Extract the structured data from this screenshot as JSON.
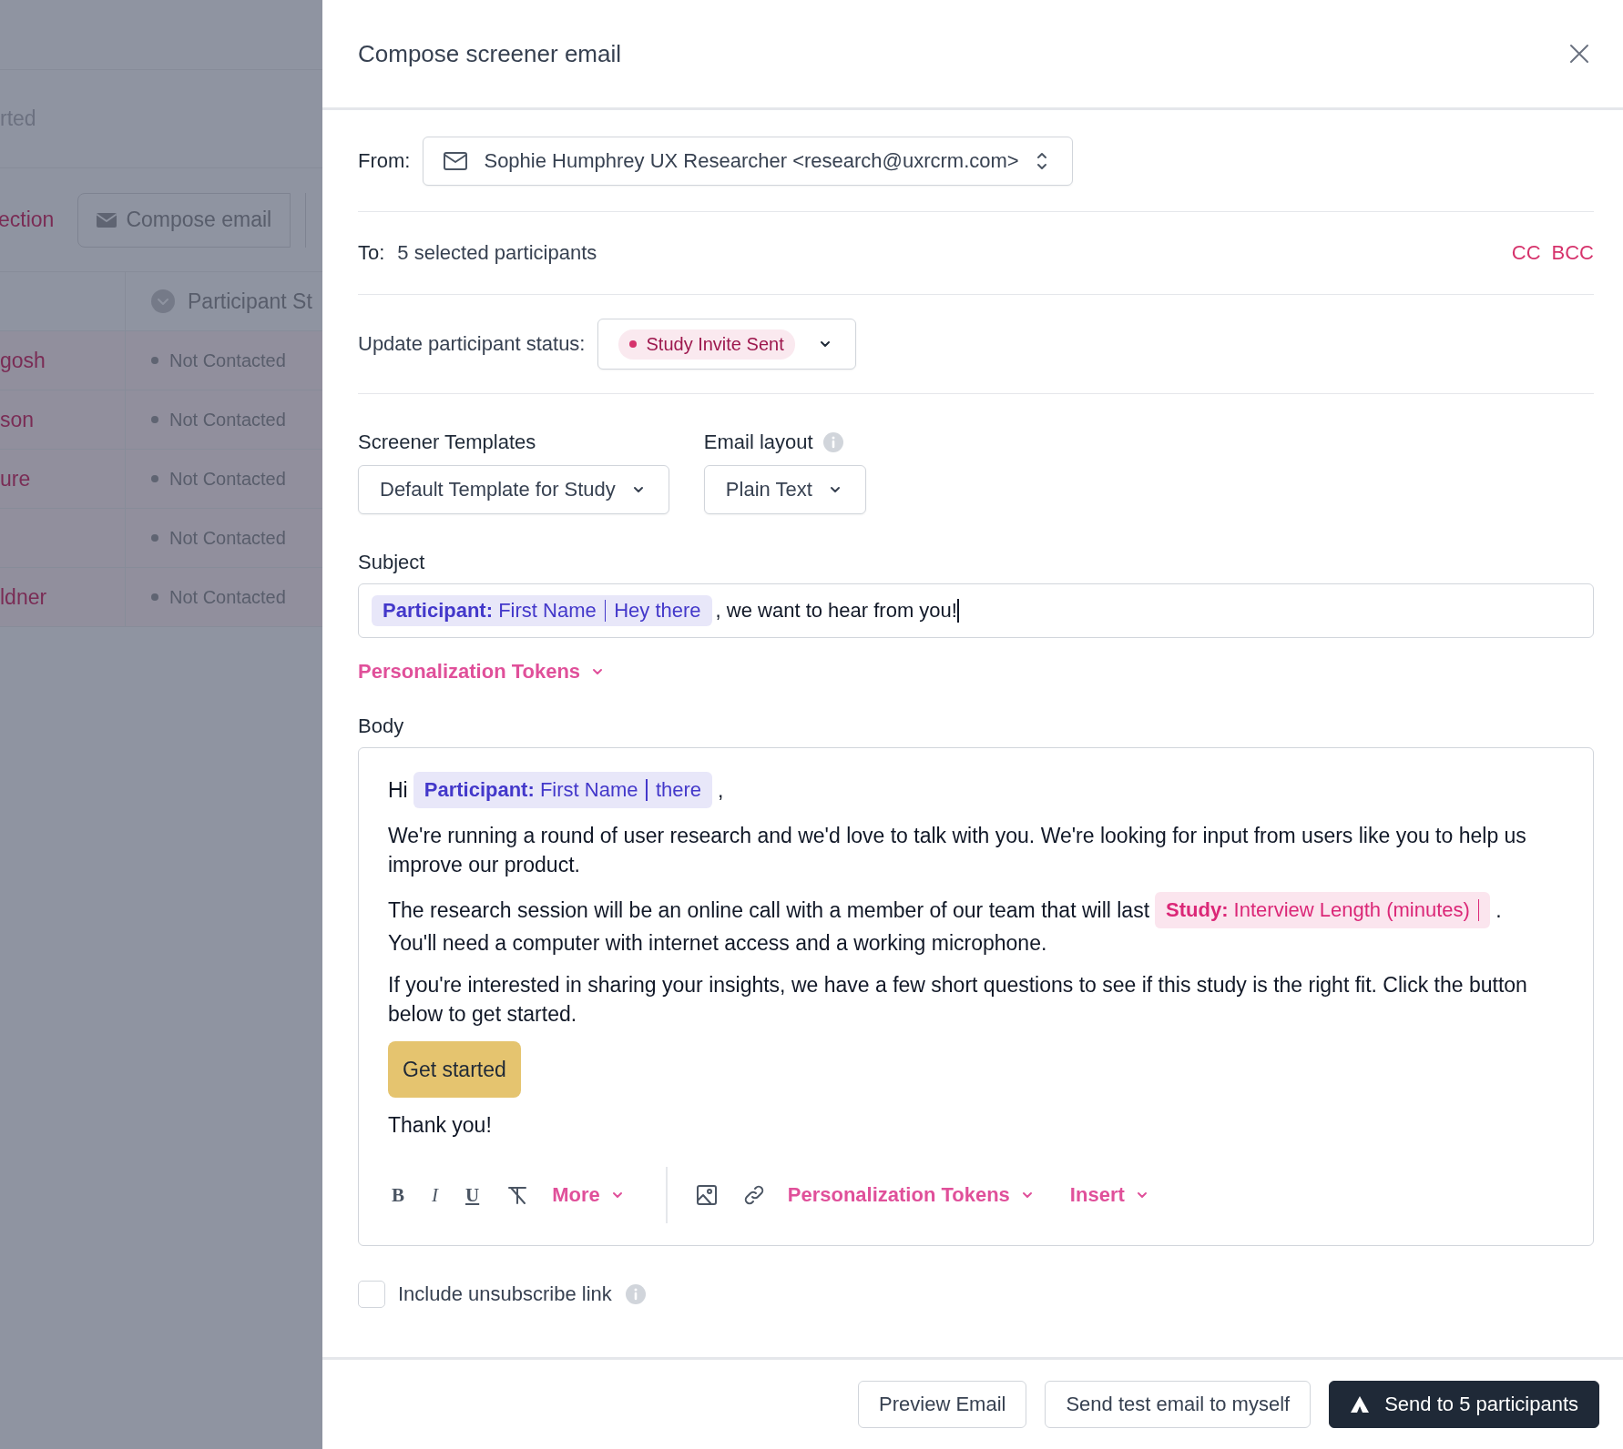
{
  "background": {
    "header_text": "rted",
    "section_link": "ection",
    "toolbar_button": "Compose email",
    "column_header": "Participant St",
    "rows": [
      {
        "name": "gosh",
        "status": "Not Contacted"
      },
      {
        "name": "son",
        "status": "Not Contacted"
      },
      {
        "name": "ure",
        "status": "Not Contacted"
      },
      {
        "status": "Not Contacted"
      },
      {
        "name": "ldner",
        "status": "Not Contacted"
      }
    ]
  },
  "modal": {
    "title": "Compose screener email",
    "from": {
      "label": "From:",
      "value": "Sophie Humphrey UX Researcher <research@uxrcrm.com>"
    },
    "to": {
      "label": "To:",
      "value": "5 selected participants",
      "links": [
        "CC",
        "BCC"
      ]
    },
    "status": {
      "label": "Update participant status:",
      "value": "Study Invite Sent",
      "color": "#d6336c"
    },
    "templates": {
      "label": "Screener Templates",
      "value": "Default Template for Study"
    },
    "layout": {
      "label": "Email layout",
      "value": "Plain Text"
    },
    "subject": {
      "label": "Subject",
      "parts": [
        {
          "kind": "token",
          "text": "**Participant:** First Name",
          "fallback": "Hey there",
          "color": "#4338ca"
        },
        {
          "kind": "text",
          "text": ", we want to hear from you!"
        }
      ]
    },
    "tokens_link": "Personalization Tokens",
    "body": {
      "label": "Body",
      "blocks": [
        {
          "kind": "paragraph",
          "parts": [
            {
              "kind": "text",
              "text": "Hi"
            },
            {
              "kind": "token",
              "text": "**Participant:** First Name",
              "fallback": "there",
              "color": "#4338ca"
            },
            {
              "kind": "text",
              "text": ","
            }
          ]
        },
        {
          "kind": "paragraph",
          "parts": [
            {
              "kind": "text",
              "text": "We're running a round of user research and we'd love to talk with you. We're looking for input from users like you to help us improve our product."
            }
          ]
        },
        {
          "kind": "paragraph",
          "parts": [
            {
              "kind": "text",
              "text": "The research session will be an online call with a member of our team that will last"
            },
            {
              "kind": "token",
              "text": "**Study:** Interview Length (minutes)",
              "color": "#db2777"
            },
            {
              "kind": "text",
              "text": "."
            },
            {
              "kind": "text",
              "text": "You'll need a computer with internet access and a working microphone."
            }
          ]
        },
        {
          "kind": "paragraph",
          "parts": [
            {
              "kind": "text",
              "text": "If you're interested in sharing your insights, we have a few short questions to see if this study is the right fit. Click the button below to get started."
            }
          ]
        },
        {
          "kind": "button",
          "text": "Get started"
        },
        {
          "kind": "paragraph",
          "parts": [
            {
              "kind": "text",
              "text": "Thank you!"
            }
          ]
        }
      ]
    },
    "toolbar": {
      "groups": [
        [
          {
            "kind": "format",
            "text": "B"
          },
          {
            "kind": "format",
            "text": "I"
          },
          {
            "kind": "format",
            "text": "U"
          },
          {
            "kind": "clear"
          },
          {
            "kind": "menu",
            "text": "More"
          }
        ],
        [
          {
            "kind": "image"
          },
          {
            "kind": "link"
          },
          {
            "kind": "menu",
            "text": "Personalization Tokens"
          },
          {
            "kind": "menu",
            "text": "Insert"
          }
        ]
      ]
    },
    "unsubscribe": {
      "label": "Include unsubscribe link",
      "checked": false
    },
    "footer": {
      "buttons": [
        {
          "kind": "secondary",
          "label": "Preview Email"
        },
        {
          "kind": "secondary",
          "label": "Send test email to myself"
        },
        {
          "kind": "primary",
          "label": "Send to 5 participants"
        }
      ]
    }
  }
}
